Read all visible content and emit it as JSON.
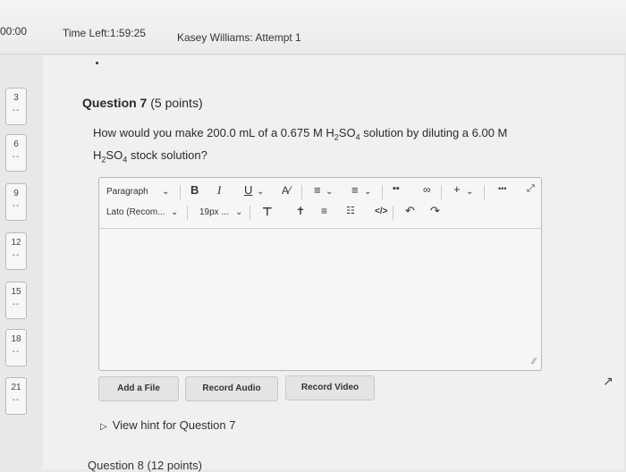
{
  "header": {
    "timer": "00:00",
    "time_left": "Time Left:1:59:25",
    "attempt": "Kasey Williams: Attempt 1"
  },
  "question_nav": [
    {
      "number": "3",
      "status": "--"
    },
    {
      "number": "6",
      "status": "--"
    },
    {
      "number": "9",
      "status": "--"
    },
    {
      "number": "12",
      "status": "--"
    },
    {
      "number": "15",
      "status": "--"
    },
    {
      "number": "18",
      "status": "--"
    },
    {
      "number": "21",
      "status": "--"
    }
  ],
  "question": {
    "title": "Question 7",
    "points": "(5 points)",
    "text_parts": {
      "p1": "How would you make 200.0 mL of a 0.675 M H",
      "sub1": "2",
      "p2": "SO",
      "sub2": "4",
      "p3": " solution by diluting a 6.00 M",
      "p4": "H",
      "sub3": "2",
      "p5": "SO",
      "sub4": "4",
      "p6": " stock solution?"
    }
  },
  "editor": {
    "paragraph_select": "Paragraph",
    "font_select": "Lato (Recom...",
    "size_select": "19px ...",
    "bold": "B",
    "italic": "I",
    "underline": "U",
    "more": "•••"
  },
  "actions": {
    "add_file": "Add a File",
    "record_audio": "Record Audio",
    "record_video": "Record Video"
  },
  "hint": {
    "label": "View hint for Question 7"
  },
  "next_question": {
    "label": "Question 8 (12 points)"
  }
}
